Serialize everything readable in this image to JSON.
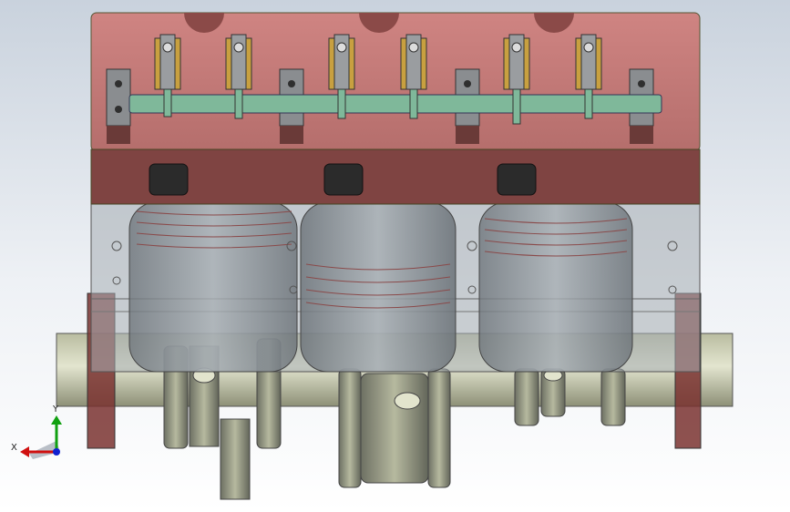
{
  "view": {
    "title": "",
    "background_top": "#c9d2dd",
    "background_bottom": "#ffffff"
  },
  "triad": {
    "x_label": "X",
    "y_label": "Y",
    "x_color": "#d01010",
    "y_color": "#10a010",
    "origin_color": "#1020d0"
  },
  "colors": {
    "head": "#c97a78",
    "head_dark": "#8f4b4a",
    "block_glass": "#9aa2a8",
    "crank": "#cfd2b8",
    "rocker_shaft": "#7fb89a",
    "valve_spring": "#c8a040"
  }
}
